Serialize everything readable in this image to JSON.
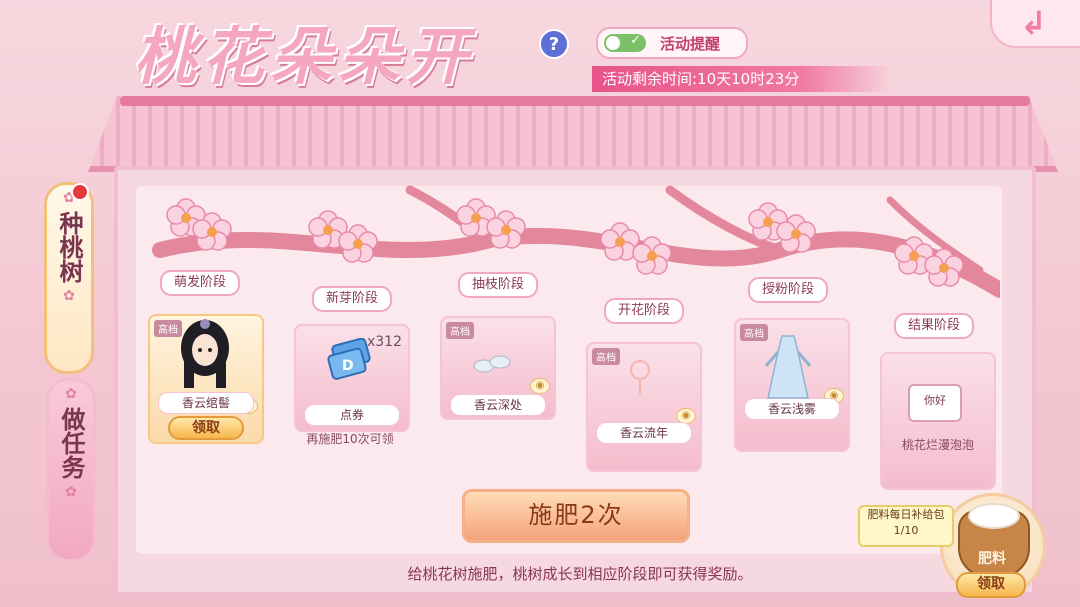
{
  "header": {
    "title": "桃花朵朵开",
    "help_glyph": "?",
    "reminder_label": "活动提醒",
    "reminder_on": true,
    "timer_text": "活动剩余时间:10天10时23分",
    "back_icon": "return-arrow-icon"
  },
  "tabs": [
    {
      "label": "种桃树",
      "active": true,
      "has_badge": true
    },
    {
      "label": "做任务",
      "active": false,
      "has_badge": false
    }
  ],
  "stages": [
    {
      "stage": "萌发阶段",
      "reward_name": "香云绾髻",
      "tier": "高档",
      "claimable": true,
      "claim_label": "领取",
      "icon": "hairstyle-avatar-icon"
    },
    {
      "stage": "新芽阶段",
      "reward_name": "点券",
      "tier": "",
      "quantity": "x312",
      "note": "再施肥10次可领",
      "icon": "coupon-icon"
    },
    {
      "stage": "抽枝阶段",
      "reward_name": "香云深处",
      "tier": "高档",
      "icon": "shoes-icon"
    },
    {
      "stage": "开花阶段",
      "reward_name": "香云流年",
      "tier": "高档",
      "icon": "hairpin-icon"
    },
    {
      "stage": "授粉阶段",
      "reward_name": "香云浅雾",
      "tier": "高档",
      "icon": "dress-icon"
    },
    {
      "stage": "结果阶段",
      "reward_name": "桃花烂漫泡泡",
      "tier": "",
      "bubble_text": "你好",
      "icon": "chat-bubble-icon"
    }
  ],
  "fertilize_button": "施肥2次",
  "hint": "给桃花树施肥，桃树成长到相应阶段即可获得奖励。",
  "fertilizer": {
    "bubble_title": "肥料每日补给包",
    "bubble_count": "1/10",
    "sack_label": "肥料",
    "claim_label": "领取"
  },
  "colors": {
    "accent_pink": "#e7548a",
    "gold": "#f6b64c",
    "background": "#f6d8e0"
  }
}
